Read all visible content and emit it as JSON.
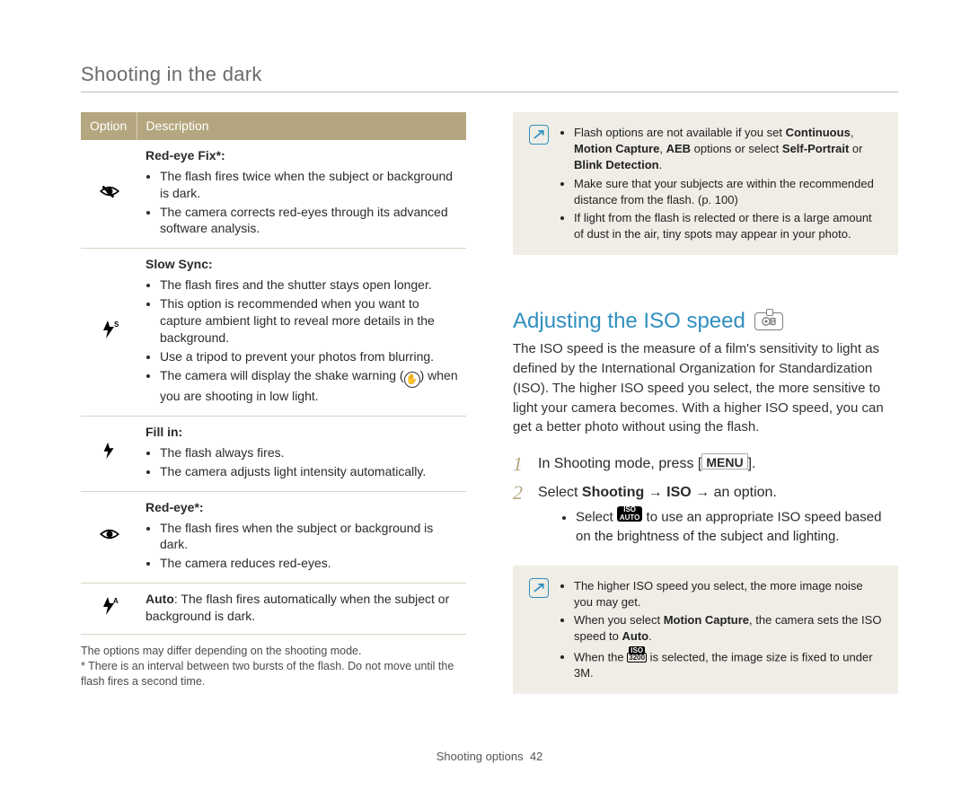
{
  "header": {
    "title": "Shooting in the dark"
  },
  "options_table": {
    "headers": {
      "option": "Option",
      "description": "Description"
    },
    "rows": [
      {
        "icon": "red-eye-fix",
        "title": "Red-eye Fix*:",
        "bullets": [
          "The flash fires twice when the subject or background is dark.",
          "The camera corrects red-eyes through its advanced software analysis."
        ]
      },
      {
        "icon": "slow-sync",
        "title": "Slow Sync:",
        "bullets": [
          "The flash fires and the shutter stays open longer.",
          "This option is recommended when you want to capture ambient light to reveal more details in the background.",
          "Use a tripod to prevent your photos from blurring.",
          "The camera will display the shake warning ( 🖐 ) when you are shooting in low light."
        ]
      },
      {
        "icon": "fill-in",
        "title": "Fill in:",
        "bullets": [
          "The flash always fires.",
          "The camera adjusts light intensity automatically."
        ]
      },
      {
        "icon": "red-eye",
        "title": "Red-eye*:",
        "bullets": [
          "The flash fires when the subject or background is dark.",
          "The camera reduces red-eyes."
        ]
      },
      {
        "icon": "auto",
        "title": "Auto",
        "inline": ": The flash fires automatically when the subject or background is dark."
      }
    ],
    "footnotes": [
      "The options may differ depending on the shooting mode.",
      "* There is an interval between two bursts of the flash. Do not move until the flash fires a second time."
    ]
  },
  "note_top": {
    "bullets": [
      "Flash options are not available if you set Continuous, Motion Capture, AEB options or select Self-Portrait or Blink Detection.",
      "Make sure that your subjects are within the recommended distance from the flash. (p. 100)",
      "If light from the flash is relected or there is a large amount of dust in the air, tiny spots may appear in your photo."
    ],
    "bold": {
      "continuous": "Continuous",
      "motion_capture": "Motion Capture",
      "aeb": "AEB",
      "self_portrait": "Self-Portrait",
      "blink": "Blink Detection"
    }
  },
  "iso": {
    "heading": "Adjusting the ISO speed",
    "mode_hint": "P",
    "desc": "The ISO speed is the measure of a film's sensitivity to light as defined by the International Organization for Standardization (ISO). The higher ISO speed you select, the more sensitive to light your camera becomes. With a higher ISO speed, you can get a better photo without using the flash.",
    "steps": [
      {
        "num": "1",
        "text_pre": "In Shooting mode, press [",
        "key": "MENU",
        "text_post": "]."
      },
      {
        "num": "2",
        "text_pre": "Select ",
        "bold1": "Shooting",
        "arrow1": " → ",
        "bold2": "ISO",
        "arrow2": " → ",
        "tail": "an option."
      }
    ],
    "step2_sub": "Select  to use an appropriate ISO speed based on the brightness of the subject and lighting.",
    "isoauto_chip_top": "ISO",
    "isoauto_chip_bot": "AUTO",
    "note": {
      "bullets": [
        "The higher ISO speed you select, the more image noise you may get.",
        "When you select Motion Capture, the camera sets the ISO speed to Auto.",
        "When the  is selected, the image size is fixed to under 3M."
      ],
      "bold": {
        "motion_capture": "Motion Capture",
        "auto": "Auto"
      },
      "iso3200_top": "ISO",
      "iso3200_bot": "3200"
    }
  },
  "footer": {
    "section": "Shooting options",
    "page": "42"
  }
}
